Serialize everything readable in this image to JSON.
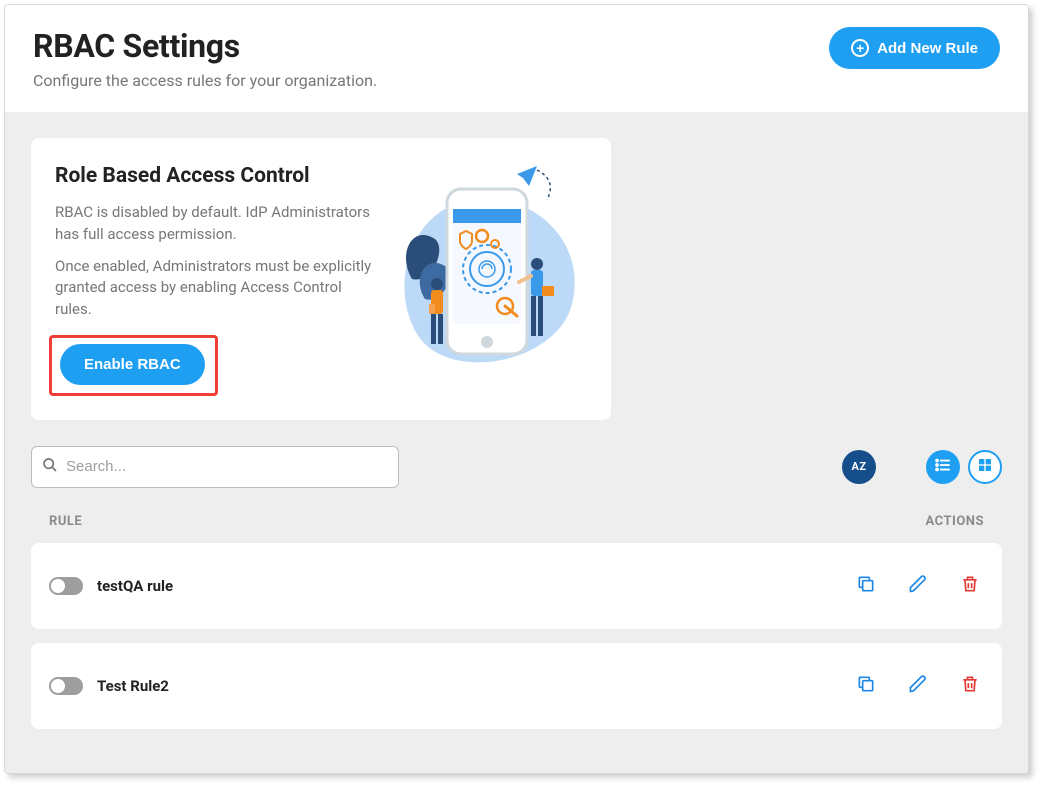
{
  "header": {
    "title": "RBAC Settings",
    "subtitle": "Configure the access rules for your organization.",
    "add_button": "Add New Rule"
  },
  "card": {
    "title": "Role Based Access Control",
    "desc1": "RBAC is disabled by default. IdP Administrators has full access permission.",
    "desc2": "Once enabled, Administrators must be explicitly granted access by enabling Access Control rules.",
    "enable_button": "Enable RBAC"
  },
  "toolbar": {
    "search_placeholder": "Search...",
    "sort_label": "AZ"
  },
  "table": {
    "col_rule": "RULE",
    "col_actions": "ACTIONS",
    "rows": [
      {
        "name": "testQA rule",
        "enabled": false
      },
      {
        "name": "Test Rule2",
        "enabled": false
      }
    ]
  },
  "colors": {
    "primary": "#1e9ff2",
    "danger": "#e53935",
    "highlight": "#ef3e36",
    "sort_bg": "#154e8a"
  }
}
